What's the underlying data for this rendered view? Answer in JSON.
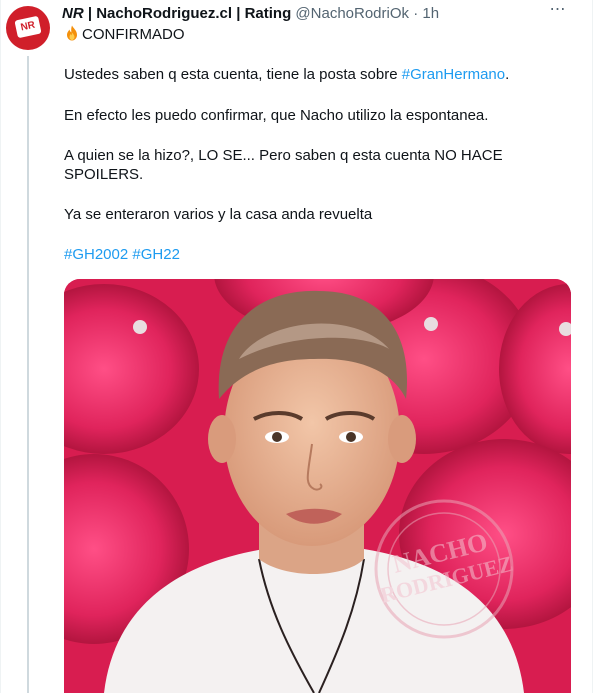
{
  "tweet": {
    "author": {
      "name_prefix": "NR",
      "name_rest": " | NachoRodriguez.cl | Rating",
      "handle": "@NachoRodriOk",
      "separator": "·",
      "time": "1h",
      "avatar_text": "NR"
    },
    "more_icon": "⋯",
    "lines": {
      "title": "CONFIRMADO",
      "p1_text": "Ustedes saben q esta cuenta, tiene la posta sobre ",
      "p1_hashtag": "#GranHermano",
      "p1_end": ".",
      "p2": "En efecto les puedo confirmar, que Nacho utilizo la espontanea.",
      "p3_line1": "A quien se la hizo?, LO SE... Pero saben q esta cuenta NO HACE",
      "p3_line2": "SPOILERS.",
      "p4": "Ya se enteraron varios y la casa anda revuelta"
    },
    "hashtags": [
      "#GH2002",
      "#GH22"
    ],
    "media": {
      "watermark_line1": "NACHO",
      "watermark_line2": "RODRIGUEZ"
    },
    "colors": {
      "link": "#1d9bf0",
      "secondary": "#536471",
      "avatar": "#d01f2a",
      "background_pink": "#e2275e"
    },
    "icons": [
      "fire-emoji-icon",
      "more-options-icon"
    ]
  }
}
